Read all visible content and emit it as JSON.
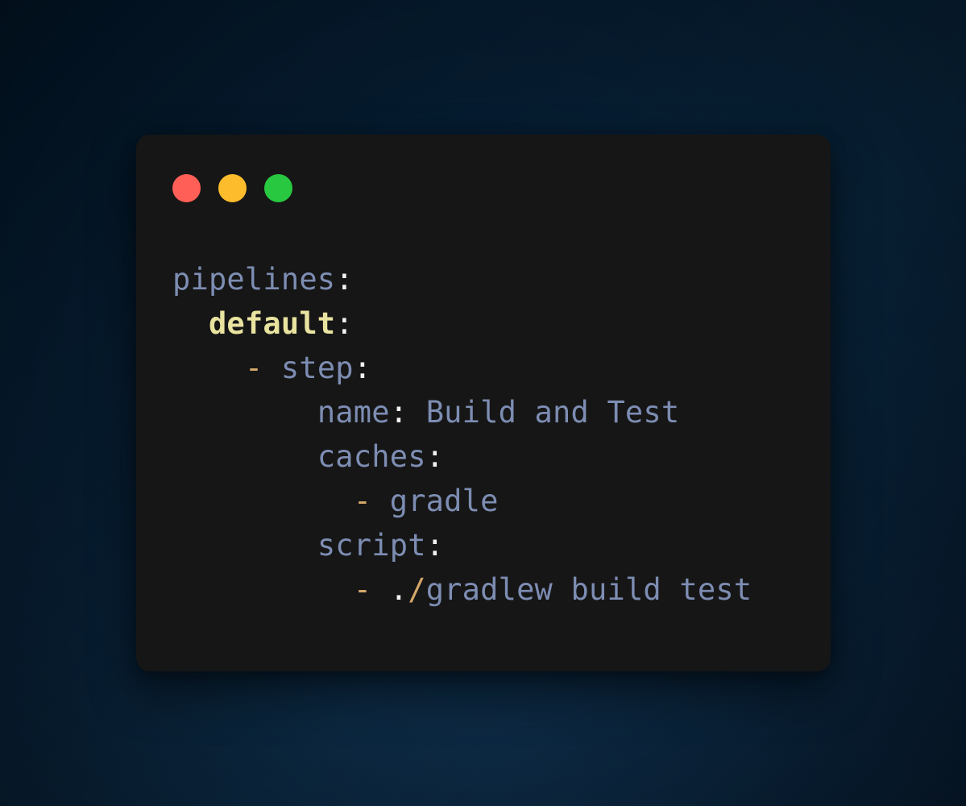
{
  "canvas": {
    "background_color": "#061b2e",
    "gradient_accent": "#08233a"
  },
  "card": {
    "background_color": "#161616",
    "corner_radius_px": 17,
    "titlebar": {
      "dots": [
        {
          "name": "close",
          "color": "#ff5f56"
        },
        {
          "name": "minimize",
          "color": "#fdbc2c"
        },
        {
          "name": "maximize",
          "color": "#28c840"
        }
      ]
    }
  },
  "syntax_colors": {
    "key": "#7d8db3",
    "anchor_key": "#e9e3a0",
    "punctuation": "#f2f2f2",
    "dash": "#d4a76a",
    "value": "#7d8db3",
    "path_slash": "#d4a76a"
  },
  "code": {
    "language": "yaml",
    "full_text": "pipelines:\n  default:\n    - step:\n        name: Build and Test\n        caches:\n          - gradle\n        script:\n          - ./gradlew build test",
    "lines": [
      {
        "indent": "",
        "tokens": [
          {
            "type": "key",
            "text": "pipelines"
          },
          {
            "type": "punct",
            "text": ":"
          }
        ]
      },
      {
        "indent": "  ",
        "tokens": [
          {
            "type": "anchor",
            "text": "default"
          },
          {
            "type": "punct",
            "text": ":"
          }
        ]
      },
      {
        "indent": "    ",
        "tokens": [
          {
            "type": "dash",
            "text": "-"
          },
          {
            "type": "space",
            "text": " "
          },
          {
            "type": "key",
            "text": "step"
          },
          {
            "type": "punct",
            "text": ":"
          }
        ]
      },
      {
        "indent": "        ",
        "tokens": [
          {
            "type": "key",
            "text": "name"
          },
          {
            "type": "punct",
            "text": ":"
          },
          {
            "type": "space",
            "text": " "
          },
          {
            "type": "value",
            "text": "Build and Test"
          }
        ]
      },
      {
        "indent": "        ",
        "tokens": [
          {
            "type": "key",
            "text": "caches"
          },
          {
            "type": "punct",
            "text": ":"
          }
        ]
      },
      {
        "indent": "          ",
        "tokens": [
          {
            "type": "dash",
            "text": "-"
          },
          {
            "type": "space",
            "text": " "
          },
          {
            "type": "value",
            "text": "gradle"
          }
        ]
      },
      {
        "indent": "        ",
        "tokens": [
          {
            "type": "key",
            "text": "script"
          },
          {
            "type": "punct",
            "text": ":"
          }
        ]
      },
      {
        "indent": "          ",
        "tokens": [
          {
            "type": "dash",
            "text": "-"
          },
          {
            "type": "space",
            "text": " "
          },
          {
            "type": "punct",
            "text": "."
          },
          {
            "type": "slash",
            "text": "/"
          },
          {
            "type": "value",
            "text": "gradlew build test"
          }
        ]
      }
    ]
  }
}
